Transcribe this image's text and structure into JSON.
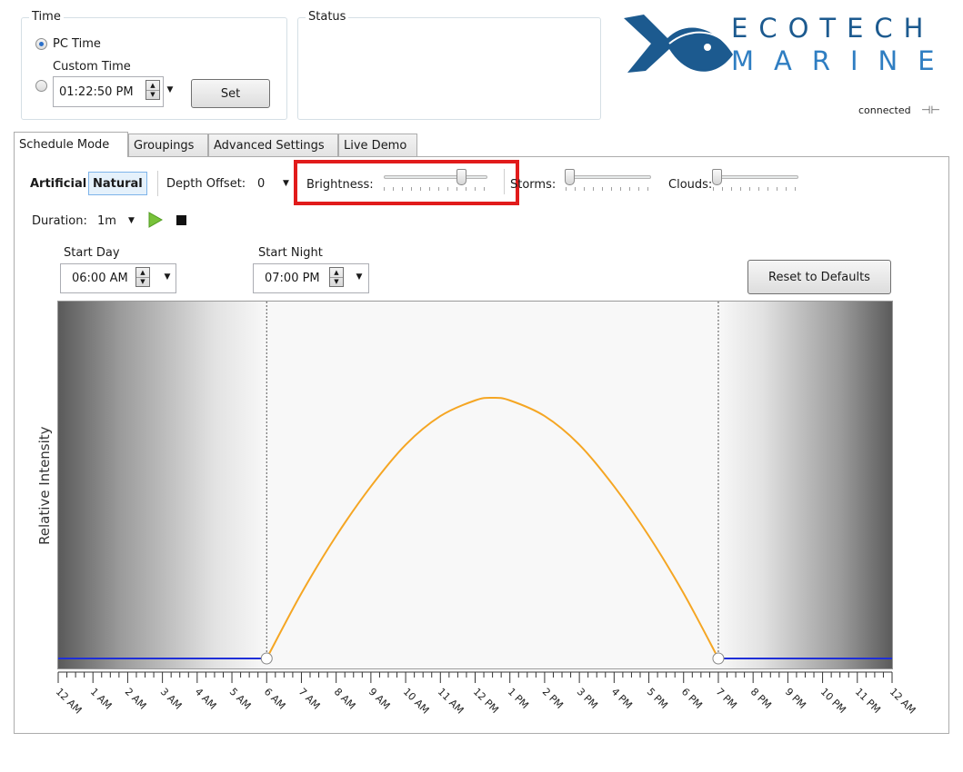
{
  "time_group": {
    "legend": "Time",
    "pc_time_label": "PC Time",
    "custom_time_label": "Custom Time",
    "custom_time_value": "01:22:50 PM",
    "set_button": "Set"
  },
  "status_group": {
    "legend": "Status"
  },
  "logo": {
    "line1": "ECOTECH",
    "line2": "MARINE",
    "brand_color": "#1c5a8f"
  },
  "connection": {
    "label": "connected",
    "icon": "plug-icon"
  },
  "tabs": [
    {
      "label": "Schedule Mode",
      "active": true
    },
    {
      "label": "Groupings",
      "active": false
    },
    {
      "label": "Advanced Settings",
      "active": false
    },
    {
      "label": "Live Demo",
      "active": false
    }
  ],
  "mode": {
    "artificial": "Artificial",
    "natural": "Natural",
    "selected": "Natural"
  },
  "depth_offset": {
    "label": "Depth Offset:",
    "value": "0"
  },
  "brightness": {
    "label": "Brightness:",
    "level": 0.85
  },
  "storms": {
    "label": "Storms:",
    "level": 0.0
  },
  "clouds": {
    "label": "Clouds:",
    "level": 0.0
  },
  "duration": {
    "label": "Duration:",
    "value": "1m"
  },
  "start_day": {
    "label": "Start Day",
    "value": "06:00 AM"
  },
  "start_night": {
    "label": "Start Night",
    "value": "07:00 PM"
  },
  "reset_button": "Reset to Defaults",
  "chart_data": {
    "type": "line",
    "ylabel": "Relative Intensity",
    "xlabel": "",
    "x_ticks": [
      "12 AM",
      "1 AM",
      "2 AM",
      "3 AM",
      "4 AM",
      "5 AM",
      "6 AM",
      "7 AM",
      "8 AM",
      "9 AM",
      "10 AM",
      "11 AM",
      "12 PM",
      "1 PM",
      "2 PM",
      "3 PM",
      "4 PM",
      "5 PM",
      "6 PM",
      "7 PM",
      "8 PM",
      "9 PM",
      "10 PM",
      "11 PM",
      "12 AM"
    ],
    "x_range_hours": [
      0,
      24
    ],
    "series": [
      {
        "color": "#f5a623",
        "x": [
          6,
          7,
          8,
          9,
          10,
          11,
          12,
          12.5,
          13,
          14,
          15,
          16,
          17,
          18,
          19
        ],
        "y": [
          0,
          0.25,
          0.47,
          0.66,
          0.82,
          0.93,
          0.99,
          1.0,
          0.99,
          0.93,
          0.82,
          0.66,
          0.47,
          0.25,
          0
        ]
      },
      {
        "color": "#1f2fd8",
        "x": [
          0,
          6
        ],
        "y": [
          0,
          0
        ]
      },
      {
        "color": "#1f2fd8",
        "x": [
          19,
          24
        ],
        "y": [
          0,
          0
        ]
      }
    ],
    "markers": [
      6,
      19
    ]
  }
}
